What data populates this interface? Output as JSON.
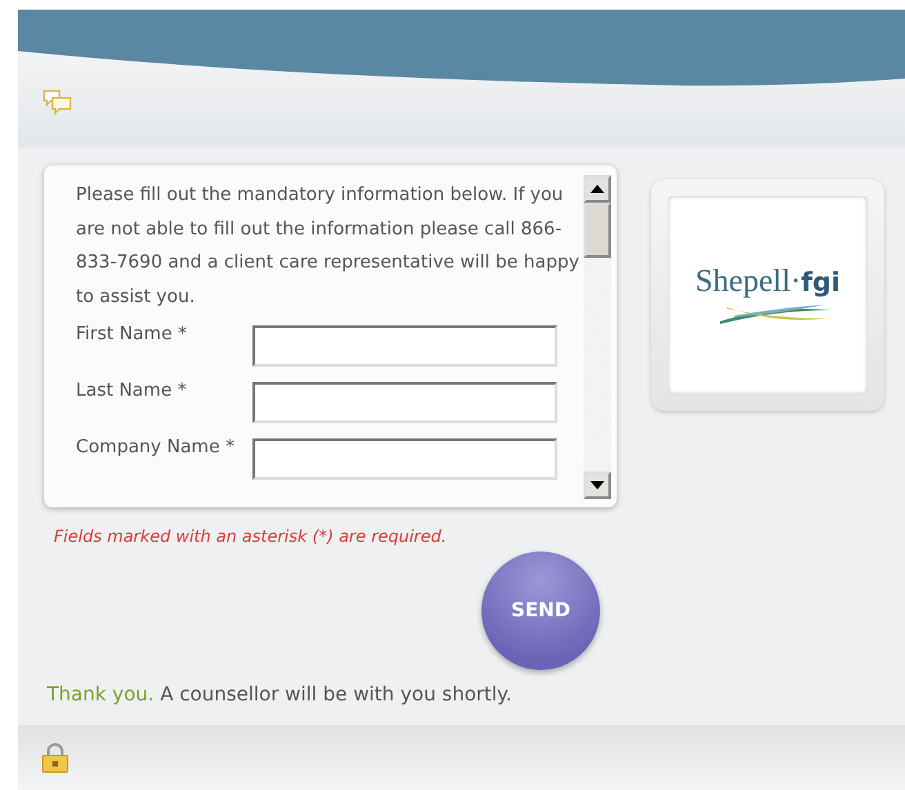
{
  "intro": "Please fill out the mandatory information below. If you are not able to fill out the information please call 866-833-7690 and a client care representative will be happy to assist you.",
  "fields": [
    {
      "label": "First Name *"
    },
    {
      "label": "Last Name *"
    },
    {
      "label": "Company Name *"
    }
  ],
  "logo": {
    "parts": [
      "Shepell·",
      "fgi"
    ]
  },
  "required_note": "Fields marked with an asterisk (*) are required.",
  "send_button": "SEND",
  "status": {
    "lead": "Thank you.",
    "text": "A counsellor will be with you shortly."
  }
}
